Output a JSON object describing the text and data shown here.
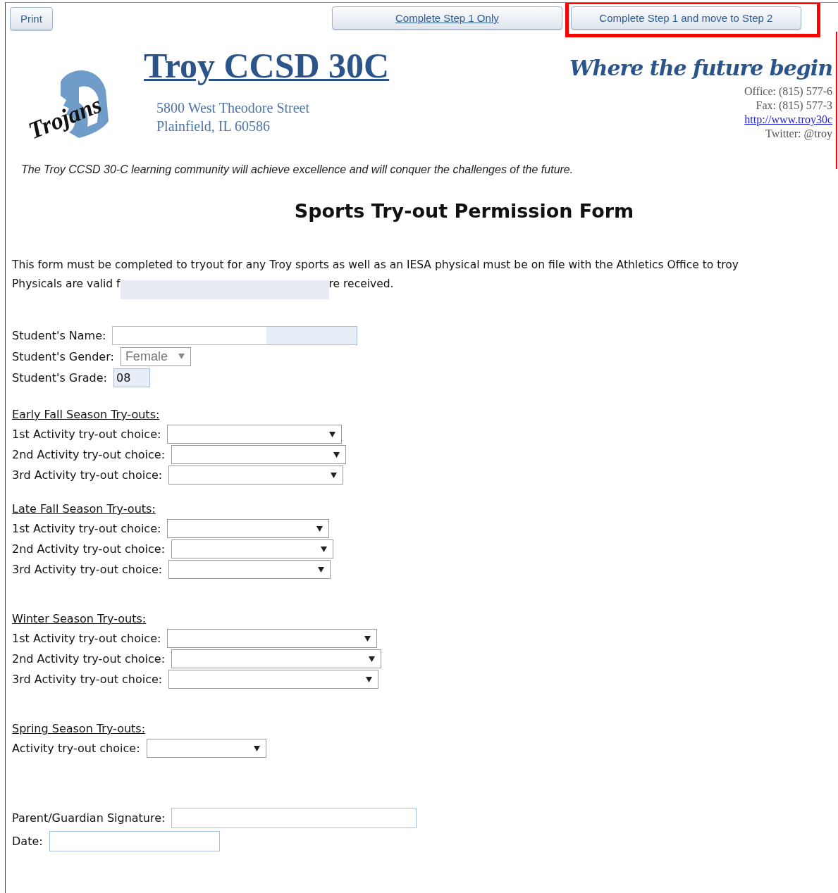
{
  "toolbar": {
    "buttons": [
      {
        "label": "Print",
        "kind": "plain",
        "highlighted": false
      },
      {
        "label": "Complete Step 1 Only",
        "kind": "link",
        "highlighted": false
      },
      {
        "label": "Complete Step 1 and move to Step 2",
        "kind": "plain",
        "highlighted": true
      }
    ]
  },
  "header": {
    "logo_text": "Trojans",
    "title": "Troy CCSD 30C",
    "address": [
      "5800 West Theodore Street",
      "Plainfield, IL 60586"
    ],
    "motto": "Where the future begin",
    "contact": [
      {
        "text": "Office: (815) 577-6",
        "kind": "text"
      },
      {
        "text": "Fax: (815) 577-3",
        "kind": "text"
      },
      {
        "text": "http://www.troy30c",
        "kind": "link"
      },
      {
        "text": "Twitter: @troy",
        "kind": "text"
      }
    ],
    "mission": "The Troy CCSD 30-C learning community will achieve excellence and will conquer the challenges of the future."
  },
  "form": {
    "title": "Sports Try-out Permission Form",
    "intro": {
      "line_1": "This form must be completed to tryout for any Troy sports as well as an IESA physical must be on file with the Athletics Office to troy",
      "line_2_before": "Physicals are valid f",
      "line_2_after": "re received."
    },
    "student_fields": [
      {
        "label": "Student's Name:",
        "kind": "text"
      },
      {
        "label": "Student's Gender:",
        "kind": "select",
        "value": "Female",
        "disabled": true
      },
      {
        "label": "Student's Grade:",
        "kind": "text",
        "value": "08"
      }
    ],
    "seasons": [
      {
        "heading": "Early Fall Season Try-outs:",
        "choices": [
          "1st Activity try-out choice:",
          "2nd Activity try-out choice:",
          "3rd Activity try-out choice:"
        ]
      },
      {
        "heading": "Late Fall Season Try-outs:",
        "choices": [
          "1st Activity try-out choice:",
          "2nd Activity try-out choice:",
          "3rd Activity try-out choice:"
        ]
      },
      {
        "heading": "Winter Season Try-outs:",
        "choices": [
          "1st Activity try-out choice:",
          "2nd Activity try-out choice:",
          "3rd Activity try-out choice:"
        ]
      },
      {
        "heading": "Spring Season Try-outs:",
        "choices": [
          "Activity try-out choice:"
        ]
      }
    ],
    "signature_fields": [
      {
        "label": "Parent/Guardian Signature:"
      },
      {
        "label": "Date:"
      }
    ]
  }
}
